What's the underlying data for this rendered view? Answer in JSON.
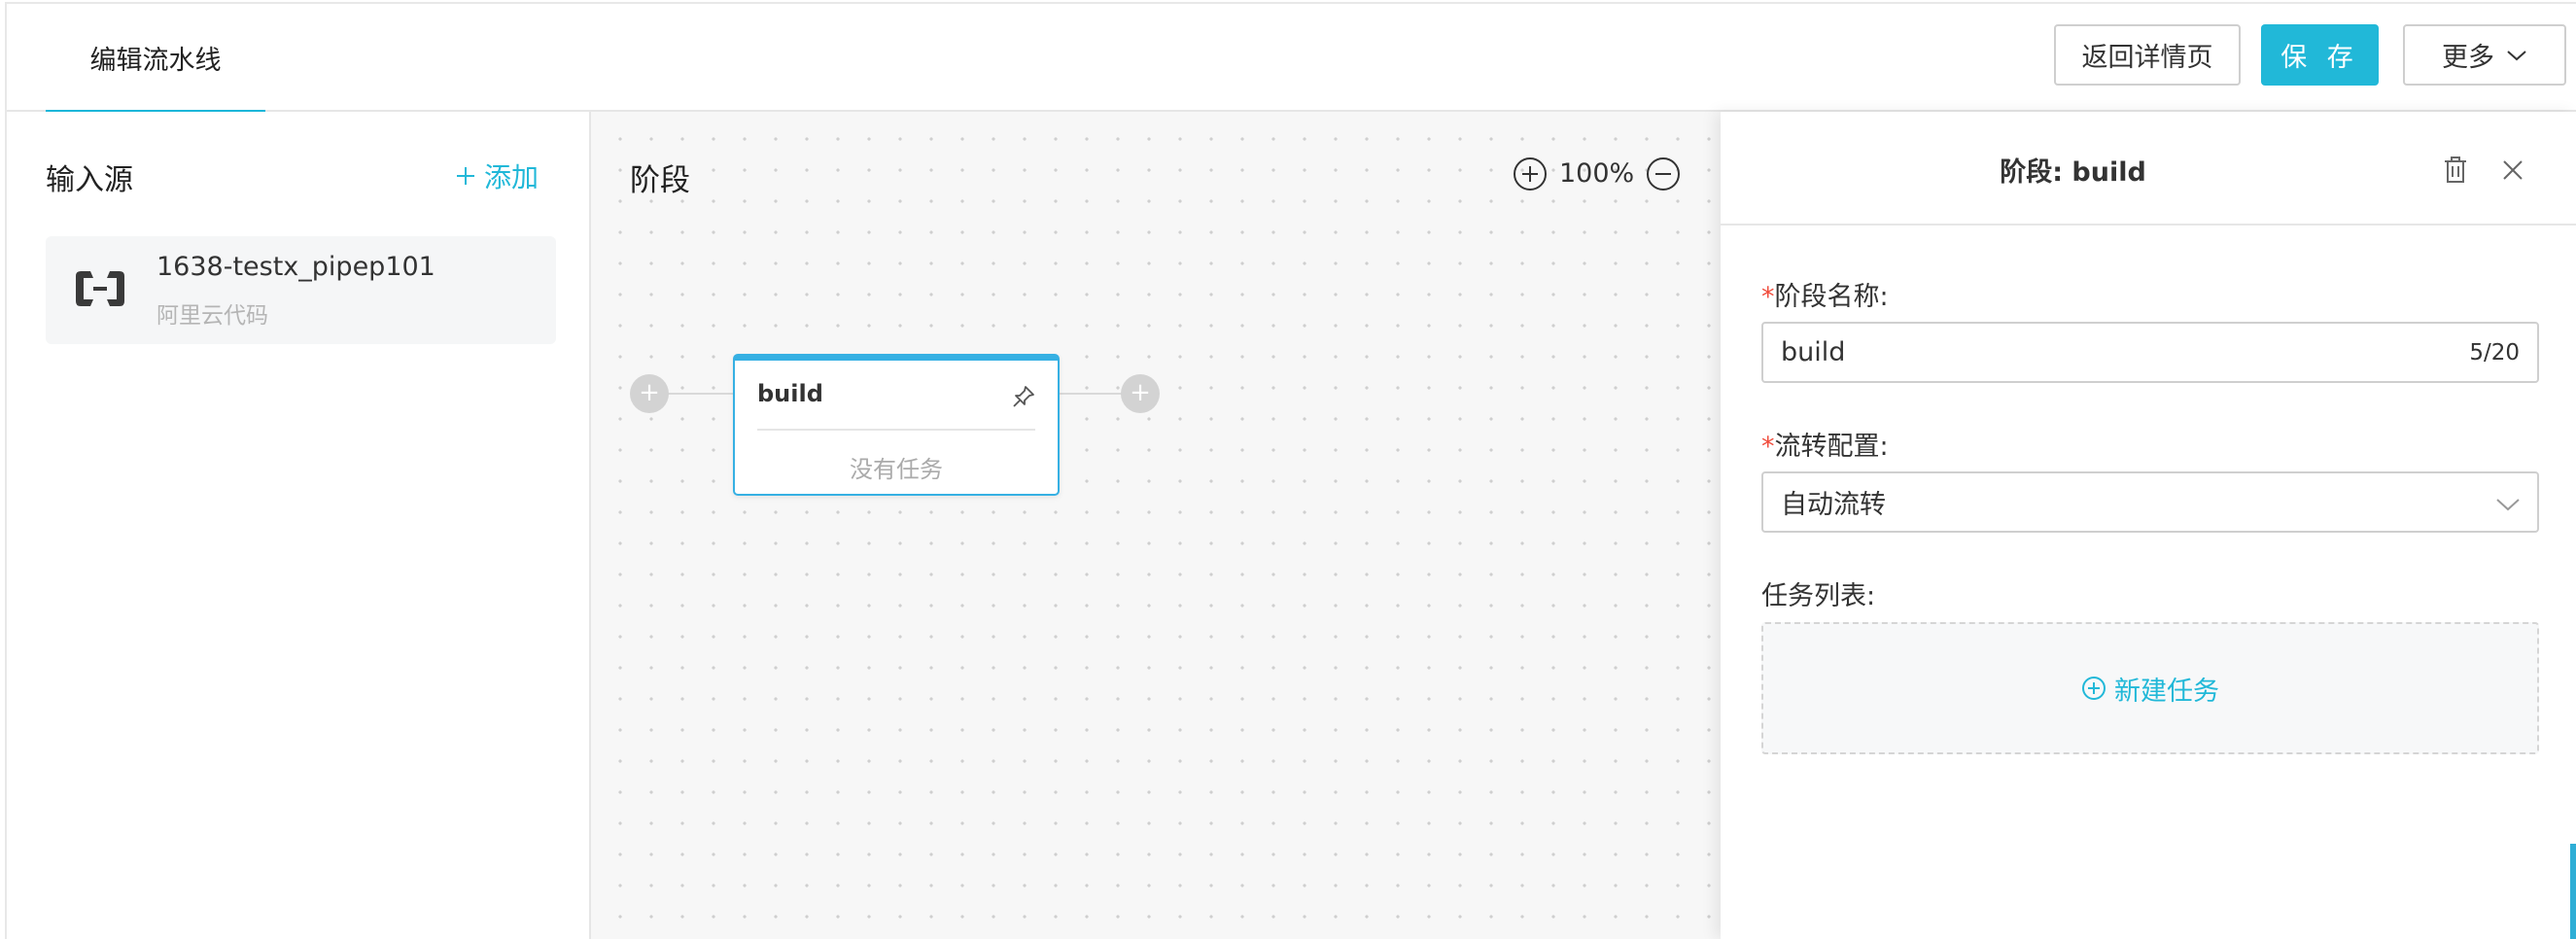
{
  "header": {
    "tab_label": "编辑流水线",
    "back_label": "返回详情页",
    "save_label": "保 存",
    "more_label": "更多"
  },
  "sources": {
    "title": "输入源",
    "add_label": "添加",
    "items": [
      {
        "name": "1638-testx_pipep101",
        "type": "阿里云代码",
        "icon": "aliyun-logo-icon"
      }
    ]
  },
  "canvas": {
    "title": "阶段",
    "zoom_level": "100%",
    "stage": {
      "name": "build",
      "empty_text": "没有任务"
    }
  },
  "drawer": {
    "title": "阶段: build",
    "stage_name_label": "阶段名称:",
    "stage_name_value": "build",
    "stage_name_counter": "5/20",
    "flow_label": "流转配置:",
    "flow_value": "自动流转",
    "task_list_label": "任务列表:",
    "new_task_label": "新建任务"
  },
  "colors": {
    "accent": "#21b8d8",
    "stage_border": "#36b0e3",
    "required": "#f04c3c"
  }
}
